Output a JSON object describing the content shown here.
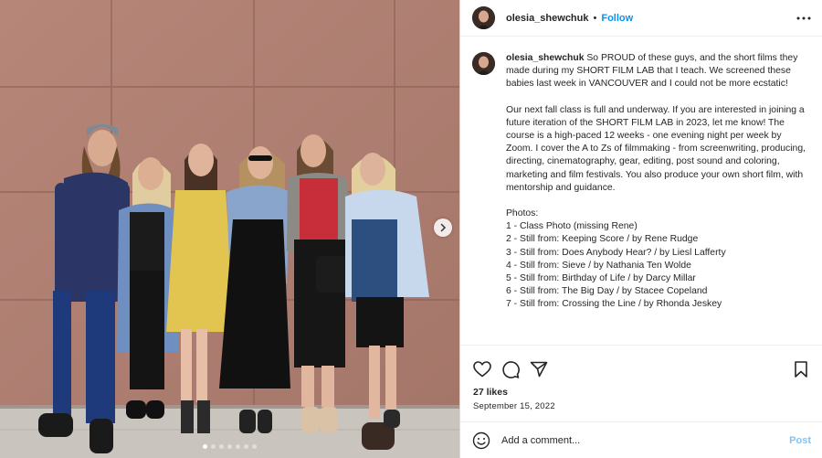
{
  "post": {
    "username": "olesia_shewchuk",
    "separator": "•",
    "follow_label": "Follow",
    "more_icon": "more-horizontal-icon",
    "caption_paragraphs": [
      "So PROUD of these guys, and the short films they made during my SHORT FILM LAB that I teach. We screened these babies last week in VANCOUVER and I could not be more ecstatic!",
      "Our next fall class is full and underway. If you are interested in joining a future iteration of the SHORT FILM LAB in 2023, let me know! The course is a high-paced 12 weeks - one evening night per week by Zoom. I cover the A to Zs of filmmaking - from screenwriting, producing, directing, cinematography, gear, editing, post sound and coloring, marketing and film festivals. You also produce your own short film, with mentorship and guidance."
    ],
    "photos_heading": "Photos:",
    "photos_list": [
      "1 - Class Photo (missing Rene)",
      "2 - Still from: Keeping Score / by Rene Rudge",
      "3 - Still from: Does Anybody Hear? / by Liesl Lafferty",
      "4 - Still from: Sieve / by Nathania Ten Wolde",
      "5 - Still from: Birthday of Life / by Darcy Millar",
      "6 - Still from: The Big Day / by Stacee Copeland",
      "7 - Still from: Crossing the Line / by Rhonda Jeskey"
    ],
    "likes": "27 likes",
    "date": "September 15, 2022",
    "comment_placeholder": "Add a comment...",
    "post_label": "Post"
  },
  "carousel": {
    "dot_count": 7,
    "active_index": 0
  },
  "icons": {
    "like": "heart-icon",
    "comment": "comment-icon",
    "share": "share-icon",
    "save": "bookmark-icon",
    "emoji": "emoji-icon",
    "next": "chevron-right-icon"
  },
  "colors": {
    "link_blue": "#0095f6",
    "post_disabled": "#7fc4f7"
  }
}
